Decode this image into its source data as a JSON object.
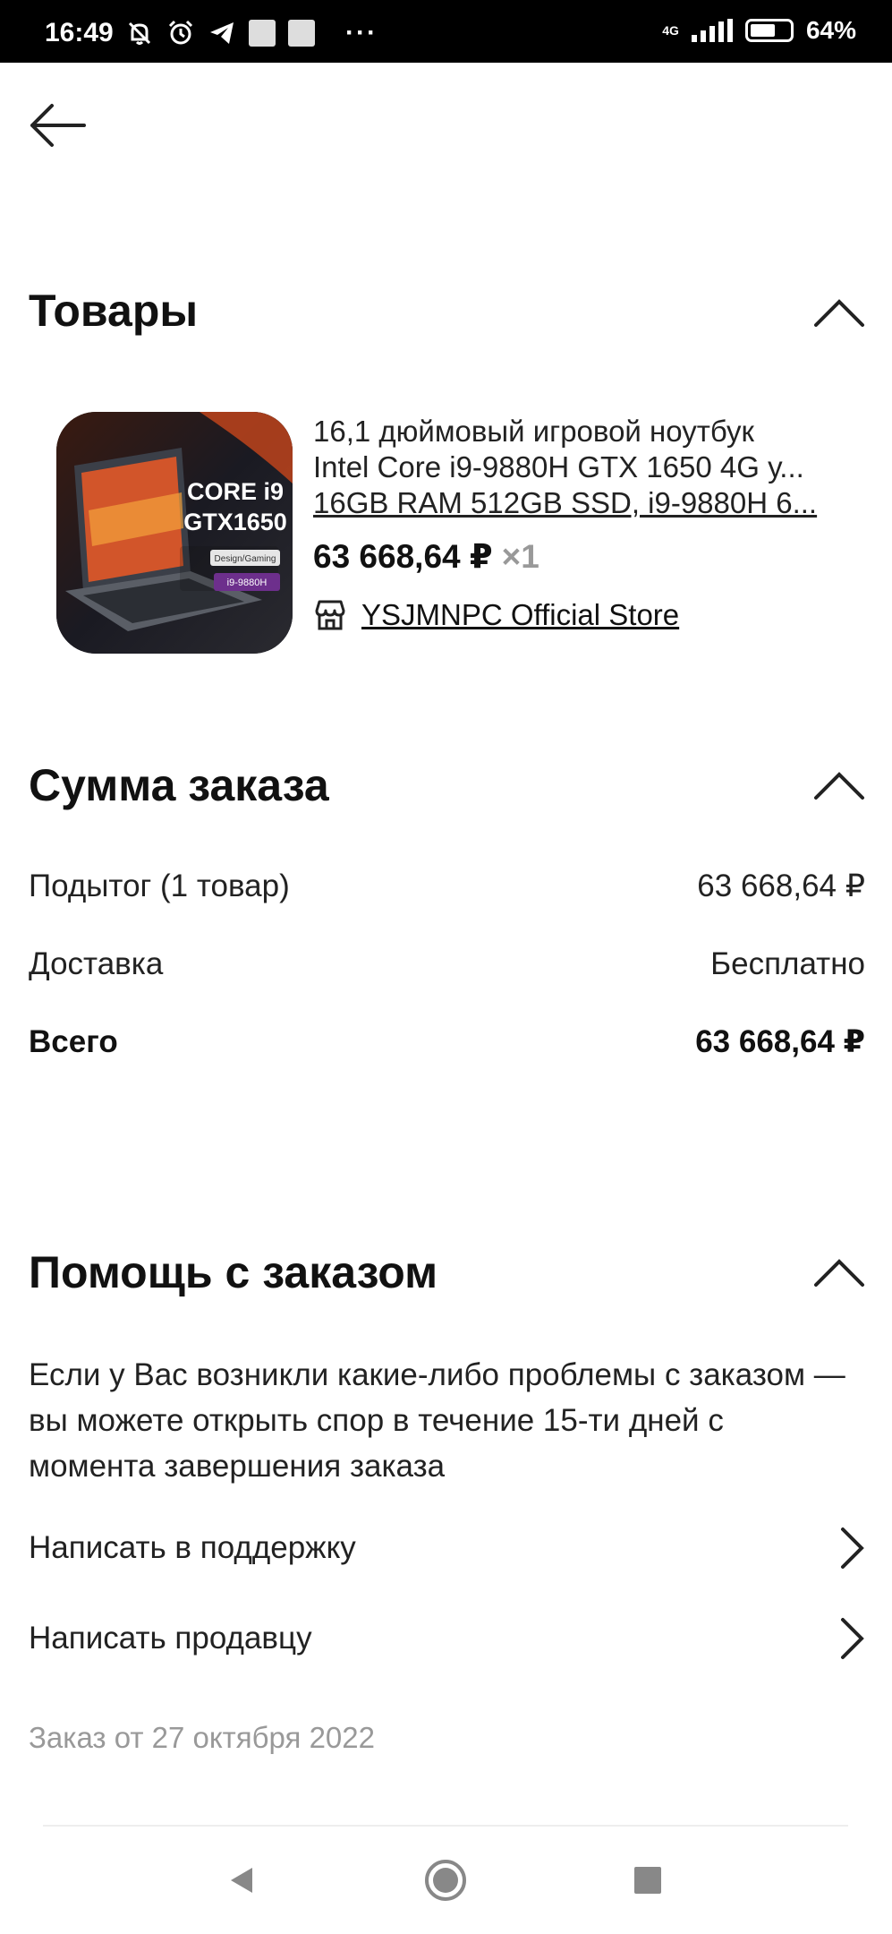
{
  "status_bar": {
    "time": "16:49",
    "network": "4G",
    "battery_percent": "64%",
    "battery_level": 0.64,
    "more": "···"
  },
  "header": {
    "back_icon": "arrow-left-icon"
  },
  "products": {
    "title": "Товары",
    "item": {
      "image_caption_line1": "CORE i9",
      "image_caption_line2": "GTX1650",
      "image_badge": "Design/Gaming",
      "image_tag": "i9-9880H",
      "title_line1": "16,1 дюймовый игровой ноутбук",
      "title_line2": "Intel Core i9-9880H GTX 1650 4G у...",
      "title_line3": "16GB RAM 512GB SSD, i9-9880H 6...",
      "price": "63 668,64 ₽",
      "quantity": "×1",
      "store": "YSJMNPC Official Store"
    }
  },
  "order_summary": {
    "title": "Сумма заказа",
    "rows": [
      {
        "label": "Подытог (1 товар)",
        "value": "63 668,64 ₽"
      },
      {
        "label": "Доставка",
        "value": "Бесплатно"
      },
      {
        "label": "Всего",
        "value": "63 668,64 ₽"
      }
    ]
  },
  "help": {
    "title": "Помощь с заказом",
    "text": "Если у Вас возникли какие-либо проблемы с заказом — вы можете открыть спор в течение 15-ти дней с момента завершения заказа",
    "links": [
      {
        "label": "Написать в поддержку"
      },
      {
        "label": "Написать продавцу"
      }
    ],
    "order_date": "Заказ от 27 октября 2022"
  },
  "colors": {
    "text": "#111111",
    "muted": "#999999",
    "statusbar": "#000000"
  }
}
